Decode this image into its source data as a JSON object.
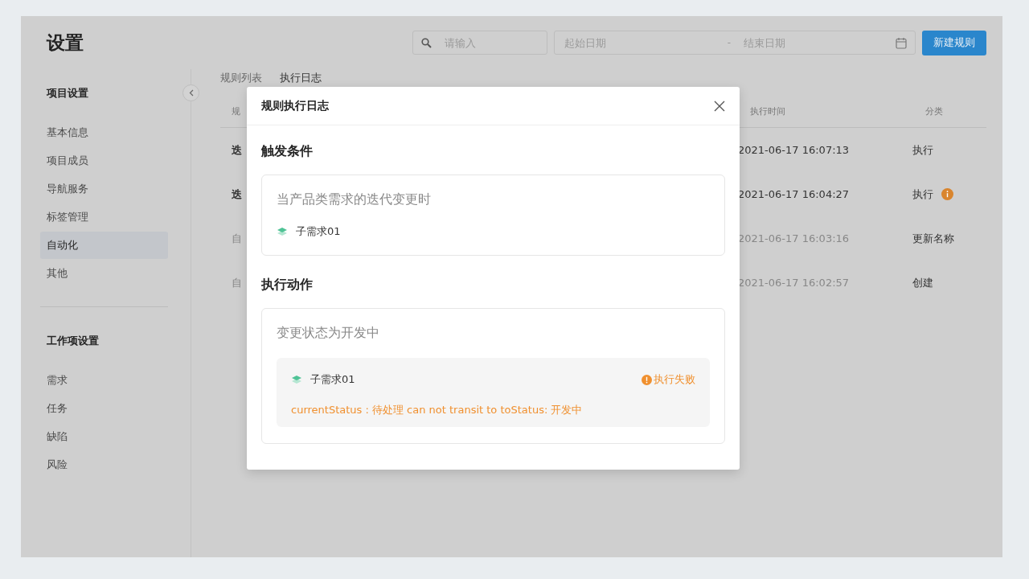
{
  "page_title": "设置",
  "search": {
    "placeholder": "请输入"
  },
  "date_range": {
    "start_placeholder": "起始日期",
    "separator": "-",
    "end_placeholder": "结束日期"
  },
  "new_rule_button": "新建规则",
  "sidebar": {
    "sections": [
      {
        "title": "项目设置",
        "items": [
          {
            "label": "基本信息",
            "selected": false
          },
          {
            "label": "项目成员",
            "selected": false
          },
          {
            "label": "导航服务",
            "selected": false
          },
          {
            "label": "标签管理",
            "selected": false
          },
          {
            "label": "自动化",
            "selected": true
          },
          {
            "label": "其他",
            "selected": false
          }
        ]
      },
      {
        "title": "工作项设置",
        "items": [
          {
            "label": "需求",
            "selected": false
          },
          {
            "label": "任务",
            "selected": false
          },
          {
            "label": "缺陷",
            "selected": false
          },
          {
            "label": "风险",
            "selected": false
          }
        ]
      }
    ]
  },
  "tabs": [
    {
      "label": "规则列表",
      "selected": false
    },
    {
      "label": "执行日志",
      "selected": true
    }
  ],
  "table": {
    "columns": [
      "规",
      "执行时间",
      "分类"
    ],
    "rows": [
      {
        "column_1": "迭",
        "time": "2021-06-17 16:07:13",
        "category": "执行",
        "dimmed": false,
        "alert": false
      },
      {
        "column_1": "迭",
        "time": "2021-06-17 16:04:27",
        "category": "执行",
        "dimmed": false,
        "alert": true
      },
      {
        "column_1": "自",
        "time": "2021-06-17 16:03:16",
        "category": "更新名称",
        "dimmed": true,
        "alert": false
      },
      {
        "column_1": "自",
        "time": "2021-06-17 16:02:57",
        "category": "创建",
        "dimmed": true,
        "alert": false
      }
    ]
  },
  "dialog": {
    "title": "规则执行日志",
    "trigger": {
      "heading": "触发条件",
      "title": "当产品类需求的迭代变更时",
      "item": "子需求01"
    },
    "action": {
      "heading": "执行动作",
      "title": "变更状态为开发中",
      "results": [
        {
          "item": "子需求01",
          "status": "执行失败",
          "failed": true,
          "message": "currentStatus : 待处理 can not transit to toStatus: 开发中"
        }
      ]
    }
  }
}
